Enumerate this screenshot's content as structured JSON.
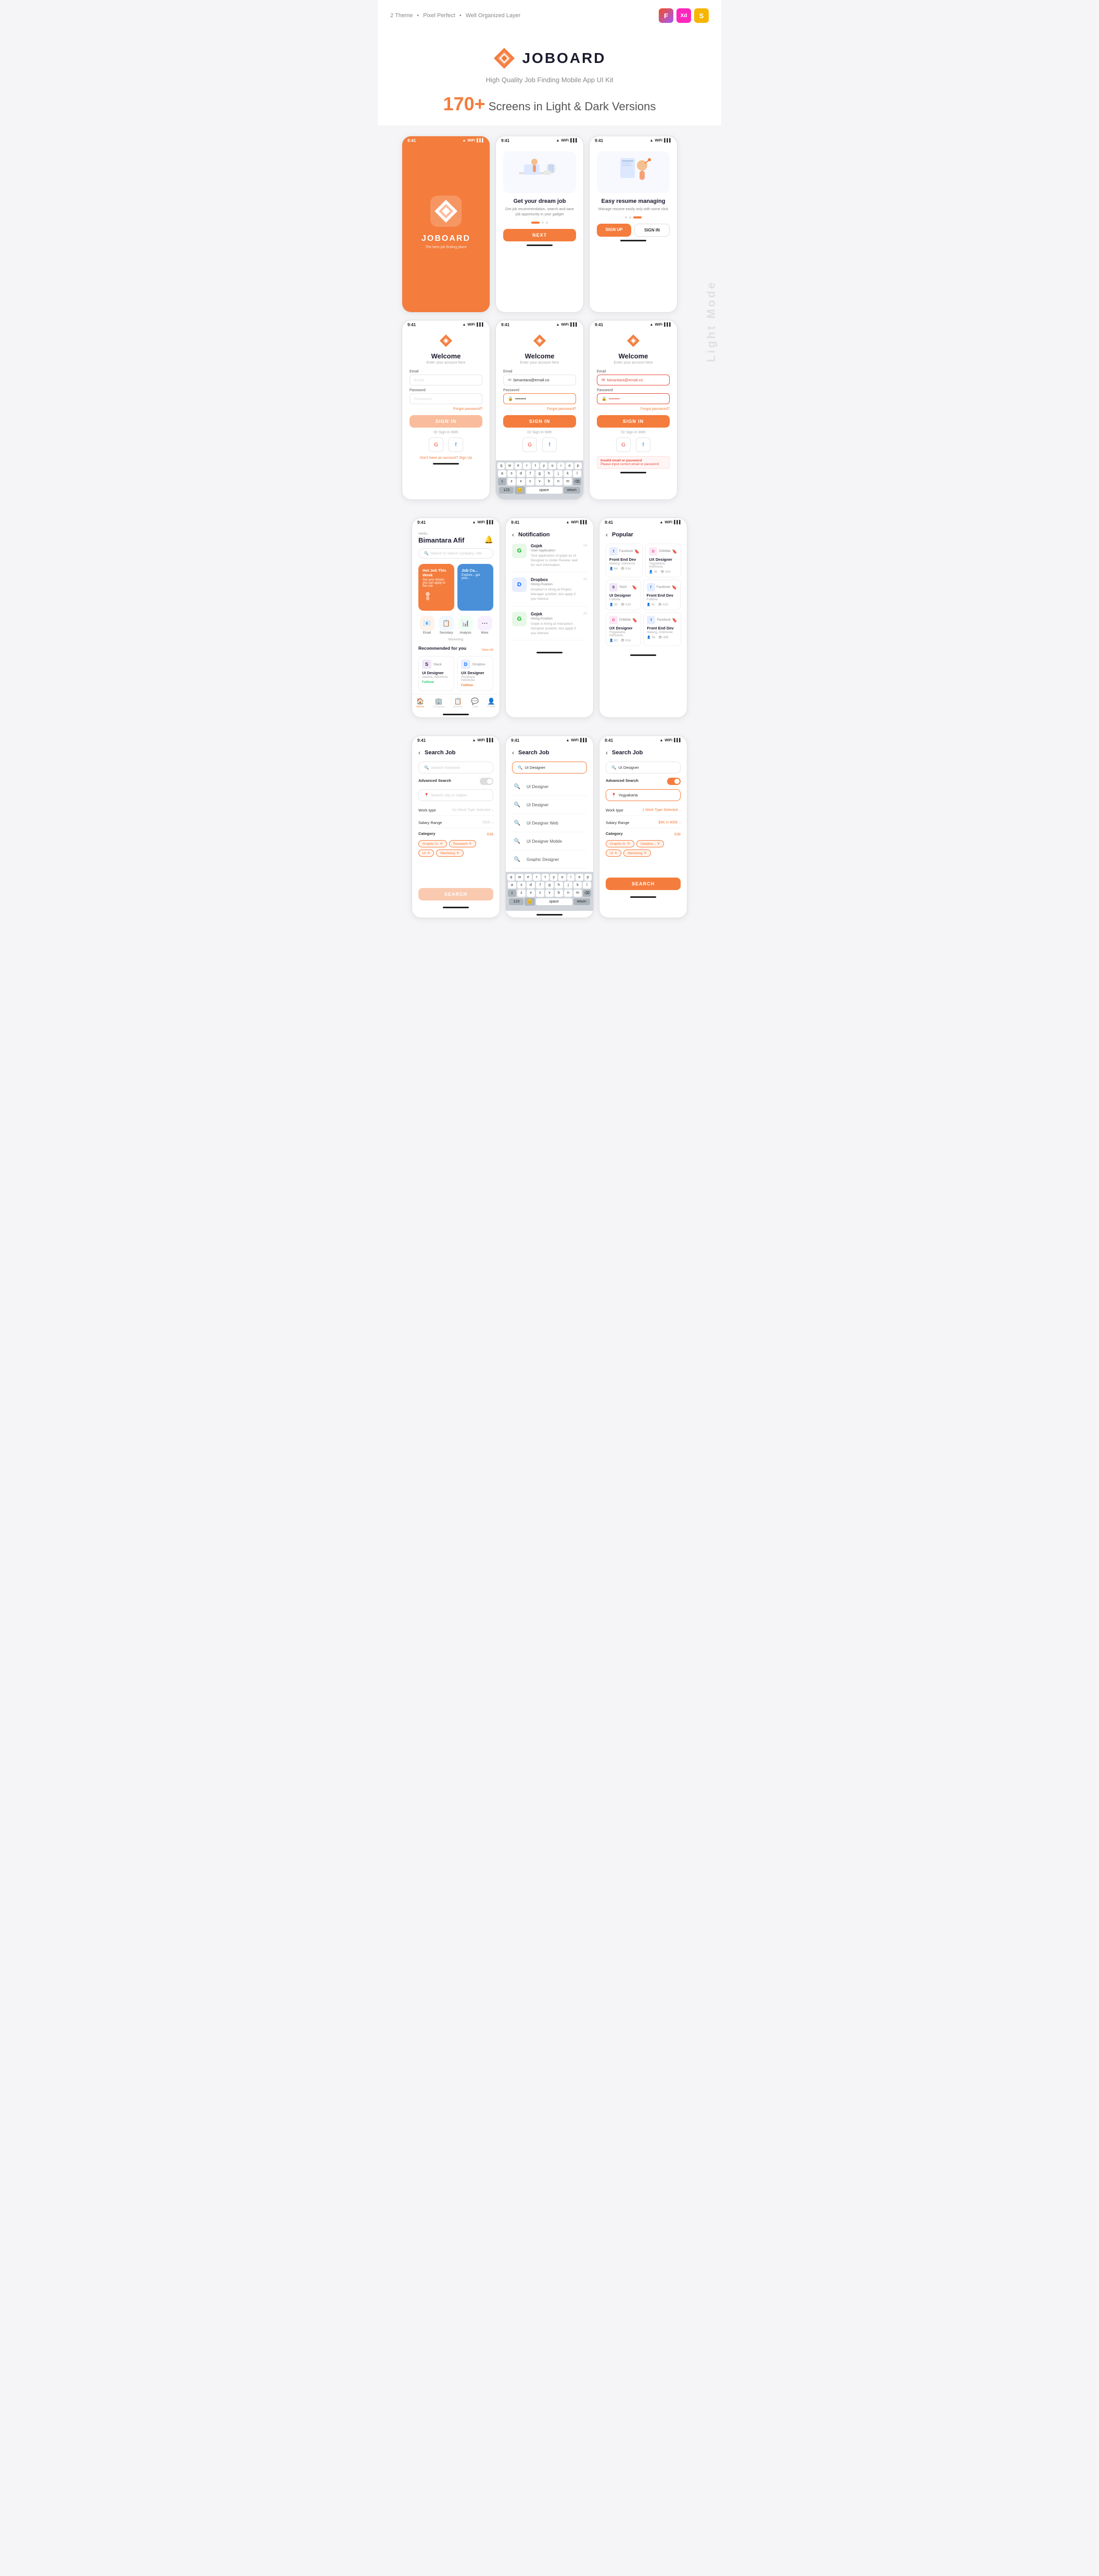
{
  "header": {
    "tags": [
      "2 Theme",
      "Pixel Perfect",
      "Well Organized Layer"
    ],
    "tools": [
      "Figma",
      "XD",
      "Sketch"
    ]
  },
  "hero": {
    "brand": "JOBOARD",
    "tagline": "High Quality Job Finding Mobile App UI Kit",
    "count": "170+",
    "count_label": "Screens in Light & Dark Versions"
  },
  "splash": {
    "title": "JOBOARD",
    "subtitle": "The best job finding place"
  },
  "onboard1": {
    "title": "Get your dream job",
    "desc": "Get job recommendation, search and save job opportunity in your gadget",
    "btn": "NEXT"
  },
  "onboard2": {
    "title": "Easy resume managing",
    "desc": "Manage resume easily only with some click",
    "btn1": "SIGN UP",
    "btn2": "SIGN IN"
  },
  "login1": {
    "welcome": "Welcome",
    "sub": "Enter your account here",
    "email_label": "Email",
    "email_placeholder": "Email",
    "password_label": "Password",
    "password_placeholder": "Password",
    "forgot": "Forgot password?",
    "btn": "SIGN IN",
    "or": "Or Sign In With",
    "signup": "Don't have an account?",
    "signup_link": "Sign Up"
  },
  "login2": {
    "welcome": "Welcome",
    "sub": "Enter your account here",
    "email_label": "Email",
    "email_value": "bimantara@email.co",
    "password_label": "Password",
    "password_value": "••••••••",
    "forgot": "Forgot password?",
    "btn": "SIGN IN",
    "or": "Or Sign In With"
  },
  "login3": {
    "welcome": "Welcome",
    "sub": "Enter your account here",
    "email_label": "Email",
    "email_value": "bimantara@email.co",
    "password_label": "Password",
    "password_value": "••••••••",
    "forgot": "Forgot password?",
    "btn": "SIGN IN",
    "or": "Or Sign In With",
    "error_title": "Invalid email or password",
    "error_desc": "Please input correct email or password"
  },
  "home": {
    "greeting": "Hello,",
    "name": "Bimantara Afif",
    "search_placeholder": "Search to search company, role",
    "banner1_title": "Hot Job This Week",
    "banner1_desc": "Get your dream you can apply to the role",
    "banner2_title": "Job Ca...",
    "banner2_desc": "Explore... get your...",
    "categories": [
      {
        "icon": "📧",
        "label": "Email",
        "color": "#fff3ec"
      },
      {
        "icon": "📋",
        "label": "Secretary",
        "color": "#f0f8ff"
      },
      {
        "icon": "📊",
        "label": "Analysis",
        "color": "#f0fff4"
      },
      {
        "icon": "⋯",
        "label": "More",
        "color": "#f8f0ff"
      }
    ],
    "marketing_label": "Marketing",
    "recommended_title": "Recommended for you",
    "view_all": "View All",
    "jobs": [
      {
        "company": "Slack",
        "logo_color": "#4a154b",
        "logo_text": "S",
        "title": "UI Designer",
        "location": "Jakarta, Indonesia",
        "status": "Fulltime",
        "status_color": "green"
      },
      {
        "company": "Dropbox",
        "logo_color": "#0061ff",
        "logo_text": "D",
        "title": "UX Designer",
        "location": "Surabaya, Indonesia",
        "status": "Fulltime",
        "status_color": "orange"
      }
    ]
  },
  "notifications": [
    {
      "company": "Gojek",
      "logo_color": "#00aa13",
      "logo_text": "G",
      "title": "Gojek",
      "sub": "User Application",
      "text": "Your application of gojek as UI Designer is Under Review, wait for next information.",
      "time": "1d"
    },
    {
      "company": "Dropbox",
      "logo_color": "#0061ff",
      "logo_text": "D",
      "title": "Dropbox",
      "sub": "Hiring Position",
      "text": "Dropbox is hiring at Project Manager position, lets apply if you interest.",
      "time": "2d"
    },
    {
      "company": "Gojek",
      "logo_color": "#00aa13",
      "logo_text": "G",
      "title": "Gojek",
      "sub": "Hiring Position",
      "text": "Gojek is hiring at Interaction Designer position, lets apply if you interest.",
      "time": "2d"
    }
  ],
  "popular": [
    {
      "company": "Facebook",
      "logo_color": "#1877f2",
      "logo_text": "f",
      "title": "Front End Dev",
      "location": "Malang, Indonesia",
      "applicants": "64",
      "views": "914"
    },
    {
      "company": "Dribbble",
      "logo_color": "#ea4c89",
      "logo_text": "D",
      "title": "UX Designer",
      "location": "Yogyakarta, Indonesia",
      "applicants": "30",
      "views": "914"
    },
    {
      "company": "Slack",
      "logo_color": "#4a154b",
      "logo_text": "S",
      "title": "UI Designer",
      "location": "Fulltime",
      "applicants": "30",
      "views": "919"
    },
    {
      "company": "Facebook",
      "logo_color": "#1877f2",
      "logo_text": "f",
      "title": "Front End Dev",
      "location": "Fulltime",
      "applicants": "41",
      "views": "419"
    },
    {
      "company": "Dribbble",
      "logo_color": "#ea4c89",
      "logo_text": "D",
      "title": "UX Designer",
      "location": "Yogyakarta, Indonesia",
      "applicants": "80",
      "views": "814"
    },
    {
      "company": "Facebook",
      "logo_color": "#1877f2",
      "logo_text": "f",
      "title": "Front End Dev",
      "location": "Malang, Indonesia",
      "applicants": "84",
      "views": "499"
    }
  ],
  "search": {
    "title": "Search Job",
    "placeholder": "Search Keyword",
    "advanced": "Advanced Search",
    "location_placeholder": "Search city or region",
    "work_type_label": "Work type",
    "work_type_value": "No Work Type Selected",
    "salary_label": "Salary Range",
    "salary_value": "500k",
    "salary_value2": "$5K in 800k",
    "category_label": "Category",
    "category_edit": "Edit",
    "tags": [
      "Graphic D. ✕",
      "Research ✕",
      "UI ✕",
      "Marketing ✕"
    ],
    "tags2": [
      "Graphic D. ✕",
      "Databas... ✕",
      "UI ✕",
      "Marketing ✕"
    ],
    "btn": "SEARCH",
    "results": [
      "UI Designer",
      "UI Designer",
      "UI Designer Web",
      "UI Designer Mobile",
      "Graphic Designer"
    ]
  },
  "light_mode_label": "Light Mode",
  "status_time": "9:41"
}
